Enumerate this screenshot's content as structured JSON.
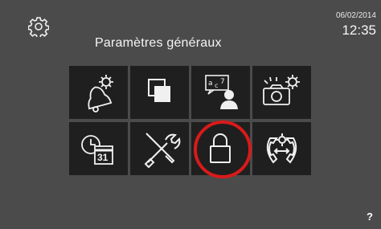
{
  "header": {
    "title": "Paramètres généraux",
    "date": "06/02/2014",
    "time": "12:35",
    "settings_icon": "gear-icon"
  },
  "tiles": [
    {
      "name": "bell-settings",
      "icon": "bell-gear-icon"
    },
    {
      "name": "screens",
      "icon": "overlapping-squares-icon"
    },
    {
      "name": "language-user",
      "icon": "language-user-icon"
    },
    {
      "name": "camera-settings",
      "icon": "camera-gear-icon"
    },
    {
      "name": "date-time",
      "icon": "clock-calendar-icon",
      "calendar_day": "31"
    },
    {
      "name": "tools",
      "icon": "tools-icon"
    },
    {
      "name": "lock",
      "icon": "padlock-icon",
      "highlighted": true
    },
    {
      "name": "call-transfer-settings",
      "icon": "handset-gear-icon"
    }
  ],
  "footer": {
    "help_label": "?"
  },
  "colors": {
    "background": "#4b4b4b",
    "tile": "#1f1f1f",
    "icon": "#f0f0f0",
    "highlight": "#d91a1a"
  }
}
